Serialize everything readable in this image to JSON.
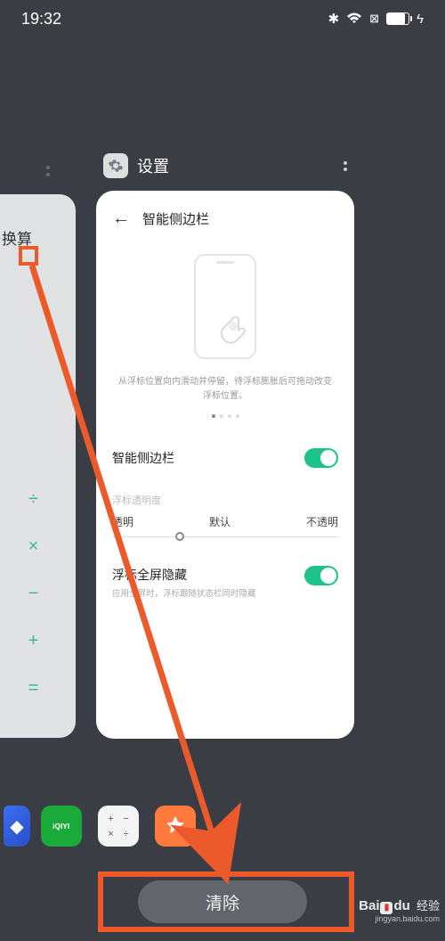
{
  "status": {
    "time": "19:32",
    "bluetooth": "✱",
    "wifi": "≋",
    "nosim": "⊠",
    "charging": "ϟ"
  },
  "left_card": {
    "title": "换算"
  },
  "calc_ops": {
    "div": "÷",
    "mul": "×",
    "sub": "−",
    "add": "+",
    "eq": "="
  },
  "settings_header": {
    "title": "设置",
    "icon": "⚙"
  },
  "card": {
    "title": "智能侧边栏",
    "caption": "从浮标位置向内滑动并停留，待浮标膨胀后可拖动改变浮标位置。",
    "row1": "智能侧边栏",
    "opacity_label": "浮标透明度",
    "slider_l": "透明",
    "slider_m": "默认",
    "slider_r": "不透明",
    "row2": "浮标全屏隐藏",
    "row2_sub": "应用全屏时，浮标跟随状态栏同时隐藏"
  },
  "dock": {
    "iqiyi": "iQIYI"
  },
  "clear": "清除",
  "watermark": {
    "brand_l": "Bai",
    "brand_r": "du",
    "suffix": "经验",
    "url": "jingyan.baidu.com"
  }
}
